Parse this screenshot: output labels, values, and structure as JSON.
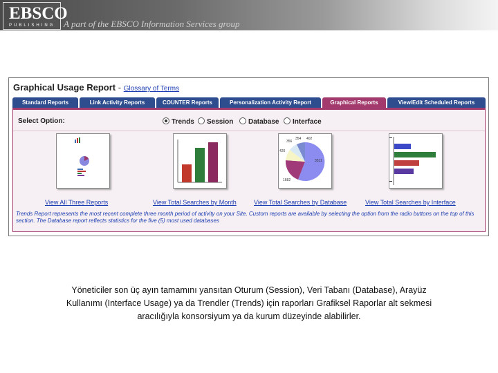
{
  "banner": {
    "logo_word": "EBSCO",
    "logo_sub": "PUBLISHING",
    "tagline": "A part of the EBSCO Information Services group"
  },
  "report": {
    "title": "Graphical Usage Report",
    "title_sep": "-",
    "glossary_link": "Glossary of Terms",
    "tabs": [
      {
        "label": "Standard Reports",
        "active": false
      },
      {
        "label": "Link Activity Reports",
        "active": false
      },
      {
        "label": "COUNTER Reports",
        "active": false
      },
      {
        "label": "Personalization Activity Report",
        "active": false
      },
      {
        "label": "Graphical Reports",
        "active": true
      },
      {
        "label": "View/Edit Scheduled Reports",
        "active": false
      }
    ],
    "select_label": "Select Option:",
    "options": [
      {
        "label": "Trends",
        "checked": true
      },
      {
        "label": "Session",
        "checked": false
      },
      {
        "label": "Database",
        "checked": false
      },
      {
        "label": "Interface",
        "checked": false
      }
    ],
    "pie_labels": [
      "356",
      "354",
      "402",
      "420",
      "3511",
      "1682"
    ],
    "links": [
      "View All Three Reports",
      "View Total Searches by Month",
      "View Total Searches by Database",
      "View Total Searches by Interface"
    ],
    "note": "Trends Report represents the most recent complete three month period of activity on your Site. Custom reports are available by selecting the option from the radio buttons on the top of this section. The Database report reflects statistics for the five (5) most used databases"
  },
  "caption": {
    "line1": "Yöneticiler son üç ayın tamamını yansıtan Oturum (Session), Veri Tabanı (Database), Arayüz",
    "line2": "Kullanımı (Interface Usage) ya da Trendler (Trends) için raporları Grafiksel Raporlar alt sekmesi",
    "line3": "aracılığıyla konsorsiyum ya da kurum düzeyinde alabilirler."
  },
  "colors": {
    "tab": "#2d4d8e",
    "tab_active": "#a23a6e",
    "link": "#1a3cb0"
  }
}
